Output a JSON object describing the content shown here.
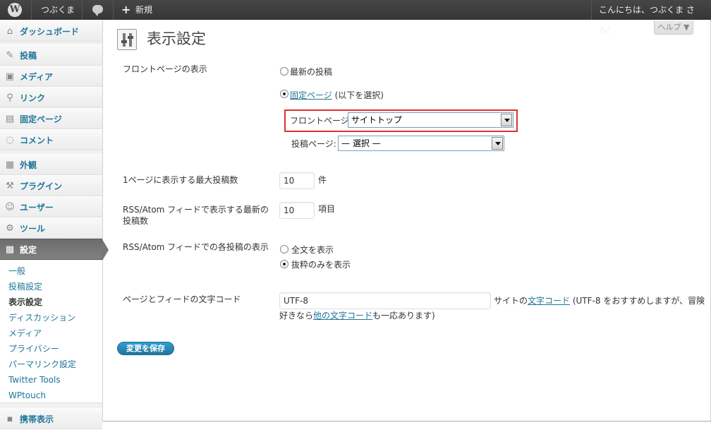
{
  "admin_bar": {
    "logo": "W",
    "site_name": "つぶくま",
    "comments_icon": "comment-bubble-icon",
    "new_label": "新規",
    "greeting": "こんにちは、つぶくま さん！"
  },
  "sidebar": {
    "items": [
      {
        "icon": "⌂",
        "label": "ダッシュボード"
      },
      {
        "icon": "✎",
        "label": "投稿"
      },
      {
        "icon": "▣",
        "label": "メディア"
      },
      {
        "icon": "⚲",
        "label": "リンク"
      },
      {
        "icon": "▤",
        "label": "固定ページ"
      },
      {
        "icon": "◌",
        "label": "コメント"
      },
      {
        "icon": "▦",
        "label": "外観"
      },
      {
        "icon": "⚒",
        "label": "プラグイン"
      },
      {
        "icon": "☺",
        "label": "ユーザー"
      },
      {
        "icon": "⚙",
        "label": "ツール"
      },
      {
        "icon": "▩",
        "label": "設定"
      },
      {
        "icon": "▪",
        "label": "携帯表示"
      }
    ],
    "submenu": [
      "一般",
      "投稿設定",
      "表示設定",
      "ディスカッション",
      "メディア",
      "プライバシー",
      "パーマリンク設定",
      "Twitter Tools",
      "WPtouch"
    ]
  },
  "help_tab": "ヘルプ ▼",
  "page": {
    "title": "表示設定",
    "front_page": {
      "label": "フロントページの表示",
      "option_latest": "最新の投稿",
      "option_static_link": "固定ページ",
      "option_static_suffix": " (以下を選択)",
      "front_select_label": "フロントページ:",
      "front_select_value": "サイトトップ",
      "posts_select_label": "投稿ページ:",
      "posts_select_value": "— 選択 —"
    },
    "posts_per_page": {
      "label": "1ページに表示する最大投稿数",
      "value": "10",
      "unit": "件"
    },
    "rss_posts": {
      "label_line1": "RSS/Atom フィードで表示する最新の",
      "label_line2": "投稿数",
      "value": "10",
      "unit": "項目"
    },
    "rss_use_excerpt": {
      "label": "RSS/Atom フィードでの各投稿の表示",
      "option_full": "全文を表示",
      "option_summary": "抜粋のみを表示"
    },
    "encoding": {
      "label": "ページとフィードの文字コード",
      "value": "UTF-8",
      "hint_pre": "サイトの",
      "hint_link1": "文字コード",
      "hint_mid": " (UTF-8 をおすすめしますが、冒険",
      "hint_line2_pre": "好きなら",
      "hint_link2": "他の文字コード",
      "hint_post": "も一応あります)"
    },
    "save_button": "変更を保存"
  }
}
